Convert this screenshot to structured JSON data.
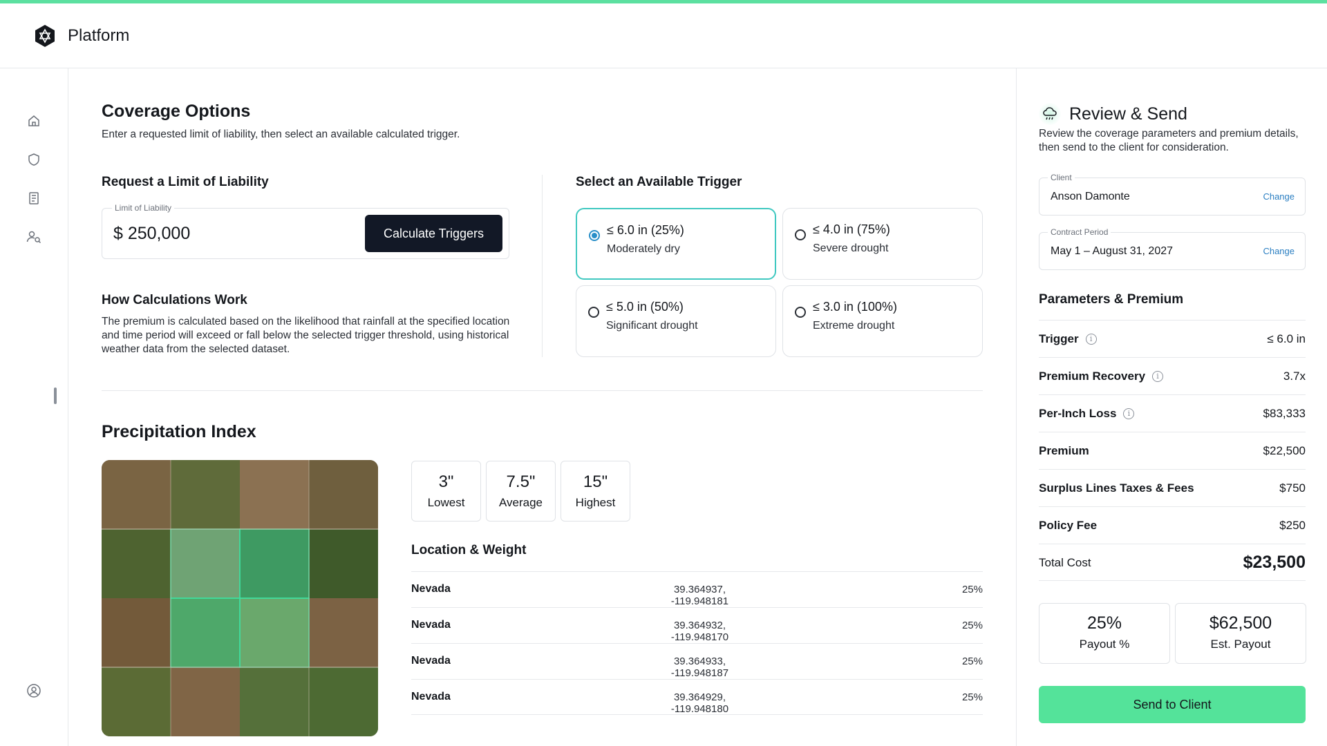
{
  "app": {
    "brand": "Platform"
  },
  "sidebar": {
    "items": [
      {
        "icon": "home-icon"
      },
      {
        "icon": "shield-icon"
      },
      {
        "icon": "document-icon"
      },
      {
        "icon": "users-search-icon"
      }
    ],
    "footer_icon": "user-circle-icon"
  },
  "coverage": {
    "title": "Coverage Options",
    "description": "Enter a requested limit of liability, then select an available calculated trigger."
  },
  "limit": {
    "title": "Request a Limit of Liability",
    "field_label": "Limit of Liability",
    "value": "$ 250,000",
    "button_label": "Calculate Triggers"
  },
  "how": {
    "title": "How Calculations Work",
    "body": "The premium is calculated based on the likelihood that rainfall at the specified location and time period will exceed or fall below the selected trigger threshold, using historical weather data from the selected dataset."
  },
  "triggers": {
    "title": "Select an Available Trigger",
    "options": [
      {
        "title": "≤ 6.0 in (25%)",
        "subtitle": "Moderately dry",
        "selected": true
      },
      {
        "title": "≤ 4.0 in (75%)",
        "subtitle": "Severe drought",
        "selected": false
      },
      {
        "title": "≤ 5.0 in (50%)",
        "subtitle": "Significant drought",
        "selected": false
      },
      {
        "title": "≤ 3.0 in (100%)",
        "subtitle": "Extreme drought",
        "selected": false
      }
    ]
  },
  "precip": {
    "title": "Precipitation Index",
    "stats": [
      {
        "value": "3\"",
        "label": "Lowest"
      },
      {
        "value": "7.5\"",
        "label": "Average"
      },
      {
        "value": "15\"",
        "label": "Highest"
      }
    ],
    "locations_title": "Location & Weight",
    "locations": [
      {
        "name": "Nevada",
        "coords": "39.364937, -119.948181",
        "weight": "25%"
      },
      {
        "name": "Nevada",
        "coords": "39.364932, -119.948170",
        "weight": "25%"
      },
      {
        "name": "Nevada",
        "coords": "39.364933, -119.948187",
        "weight": "25%"
      },
      {
        "name": "Nevada",
        "coords": "39.364929, -119.948180",
        "weight": "25%"
      }
    ]
  },
  "review": {
    "title": "Review & Send",
    "description": "Review the coverage parameters and premium details, then send to the client for consideration.",
    "client_label": "Client",
    "client_value": "Anson Damonte",
    "contract_label": "Contract Period",
    "contract_value": "May 1 – August 31, 2027",
    "change_label": "Change",
    "params_title": "Parameters & Premium",
    "params": [
      {
        "label": "Trigger",
        "value": "≤ 6.0 in",
        "info": "i"
      },
      {
        "label": "Premium Recovery",
        "value": "3.7x",
        "info": "i"
      },
      {
        "label": "Per-Inch Loss",
        "value": "$83,333",
        "info": "i"
      },
      {
        "label": "Premium",
        "value": "$22,500"
      },
      {
        "label": "Surplus Lines Taxes & Fees",
        "value": "$750"
      },
      {
        "label": "Policy Fee",
        "value": "$250"
      },
      {
        "label": "Total Cost",
        "value": "$23,500"
      }
    ],
    "payout_pct": {
      "value": "25%",
      "label": "Payout %"
    },
    "payout_est": {
      "value": "$62,500",
      "label": "Est. Payout"
    },
    "send_label": "Send to Client"
  },
  "colors": {
    "accent": "#5ce0a0",
    "button_dark": "#121826",
    "selected_border": "#3fc8c0",
    "link": "#2b7fc2"
  }
}
